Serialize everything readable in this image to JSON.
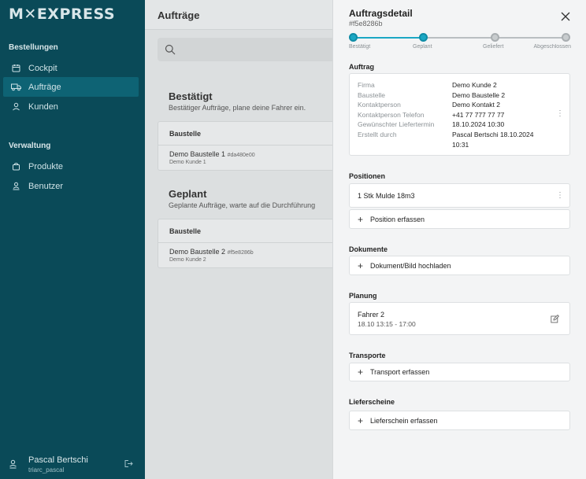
{
  "sidebar": {
    "logo": "M✕EXPRESS",
    "sections": [
      {
        "label": "Bestellungen"
      },
      {
        "label": "Verwaltung"
      }
    ],
    "items": [
      {
        "label": "Cockpit",
        "icon": "calendar-icon"
      },
      {
        "label": "Aufträge",
        "icon": "truck-icon",
        "active": true
      },
      {
        "label": "Kunden",
        "icon": "person-icon"
      },
      {
        "label": "Produkte",
        "icon": "bag-icon"
      },
      {
        "label": "Benutzer",
        "icon": "user-badge-icon"
      }
    ],
    "user": {
      "name": "Pascal Bertschi",
      "login": "triarc_pascal"
    }
  },
  "main": {
    "title": "Aufträge",
    "groups": [
      {
        "title": "Bestätigt",
        "subtitle": "Bestätiger Aufträge, plane deine Fahrer ein.",
        "column": "Baustelle",
        "rows": [
          {
            "name": "Demo Baustelle 1",
            "id": "#da480e00",
            "customer": "Demo Kunde 1"
          }
        ]
      },
      {
        "title": "Geplant",
        "subtitle": "Geplante Aufträge, warte auf die Durchführung",
        "column": "Baustelle",
        "rows": [
          {
            "name": "Demo Baustelle 2",
            "id": "#f5e8286b",
            "customer": "Demo Kunde 2"
          }
        ]
      }
    ]
  },
  "detail": {
    "title": "Auftragsdetail",
    "id": "#f5e8286b",
    "steps": [
      {
        "label": "Bestätigt",
        "done": true
      },
      {
        "label": "Geplant",
        "done": true
      },
      {
        "label": "Geliefert",
        "done": false
      },
      {
        "label": "Abgeschlossen",
        "done": false
      }
    ],
    "order": {
      "section": "Auftrag",
      "fields": [
        {
          "key": "Firma",
          "value": "Demo Kunde 2"
        },
        {
          "key": "Baustelle",
          "value": "Demo Baustelle 2"
        },
        {
          "key": "Kontaktperson",
          "value": "Demo Kontakt 2"
        },
        {
          "key": "Kontaktperson Telefon",
          "value": "+41 77 777 77 77"
        },
        {
          "key": "Gewünschter Liefertermin",
          "value": "18.10.2024 10:30"
        },
        {
          "key": "Erstellt durch",
          "value": "Pascal Bertschi 18.10.2024 10:31"
        }
      ]
    },
    "positions": {
      "section": "Positionen",
      "items": [
        {
          "label": "1 Stk Mulde 18m3"
        }
      ],
      "add_label": "Position erfassen"
    },
    "documents": {
      "section": "Dokumente",
      "add_label": "Dokument/Bild hochladen"
    },
    "planning": {
      "section": "Planung",
      "driver": "Fahrer 2",
      "time": "18.10 13:15 - 17:00"
    },
    "transports": {
      "section": "Transporte",
      "add_label": "Transport erfassen"
    },
    "delivery_notes": {
      "section": "Lieferscheine",
      "add_label": "Lieferschein erfassen"
    }
  },
  "colors": {
    "sidebar_bg": "#0a4a58",
    "sidebar_active": "#0e6374",
    "accent": "#1ba7c4",
    "step_inactive": "#c8ccce"
  }
}
